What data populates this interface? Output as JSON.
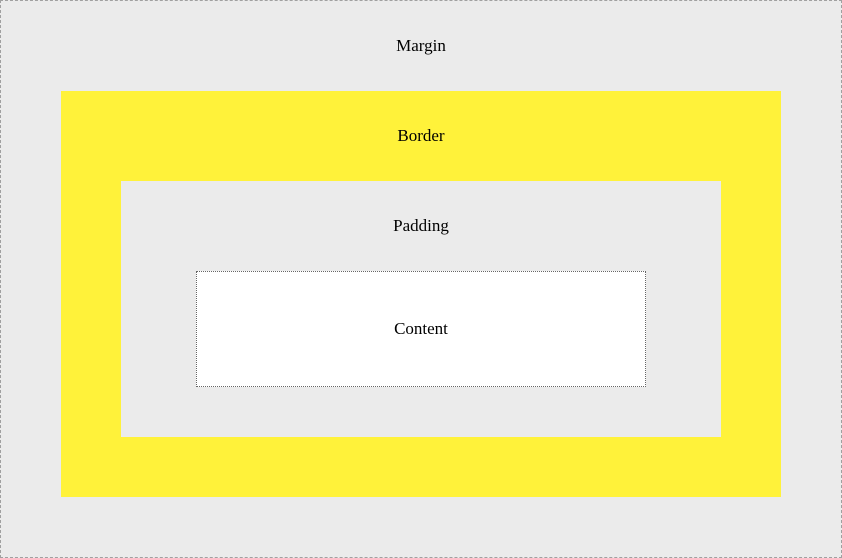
{
  "boxmodel": {
    "margin_label": "Margin",
    "border_label": "Border",
    "padding_label": "Padding",
    "content_label": "Content",
    "colors": {
      "margin_bg": "#ebebeb",
      "border_bg": "#fff23a",
      "padding_bg": "#ebebeb",
      "content_bg": "#ffffff"
    }
  }
}
